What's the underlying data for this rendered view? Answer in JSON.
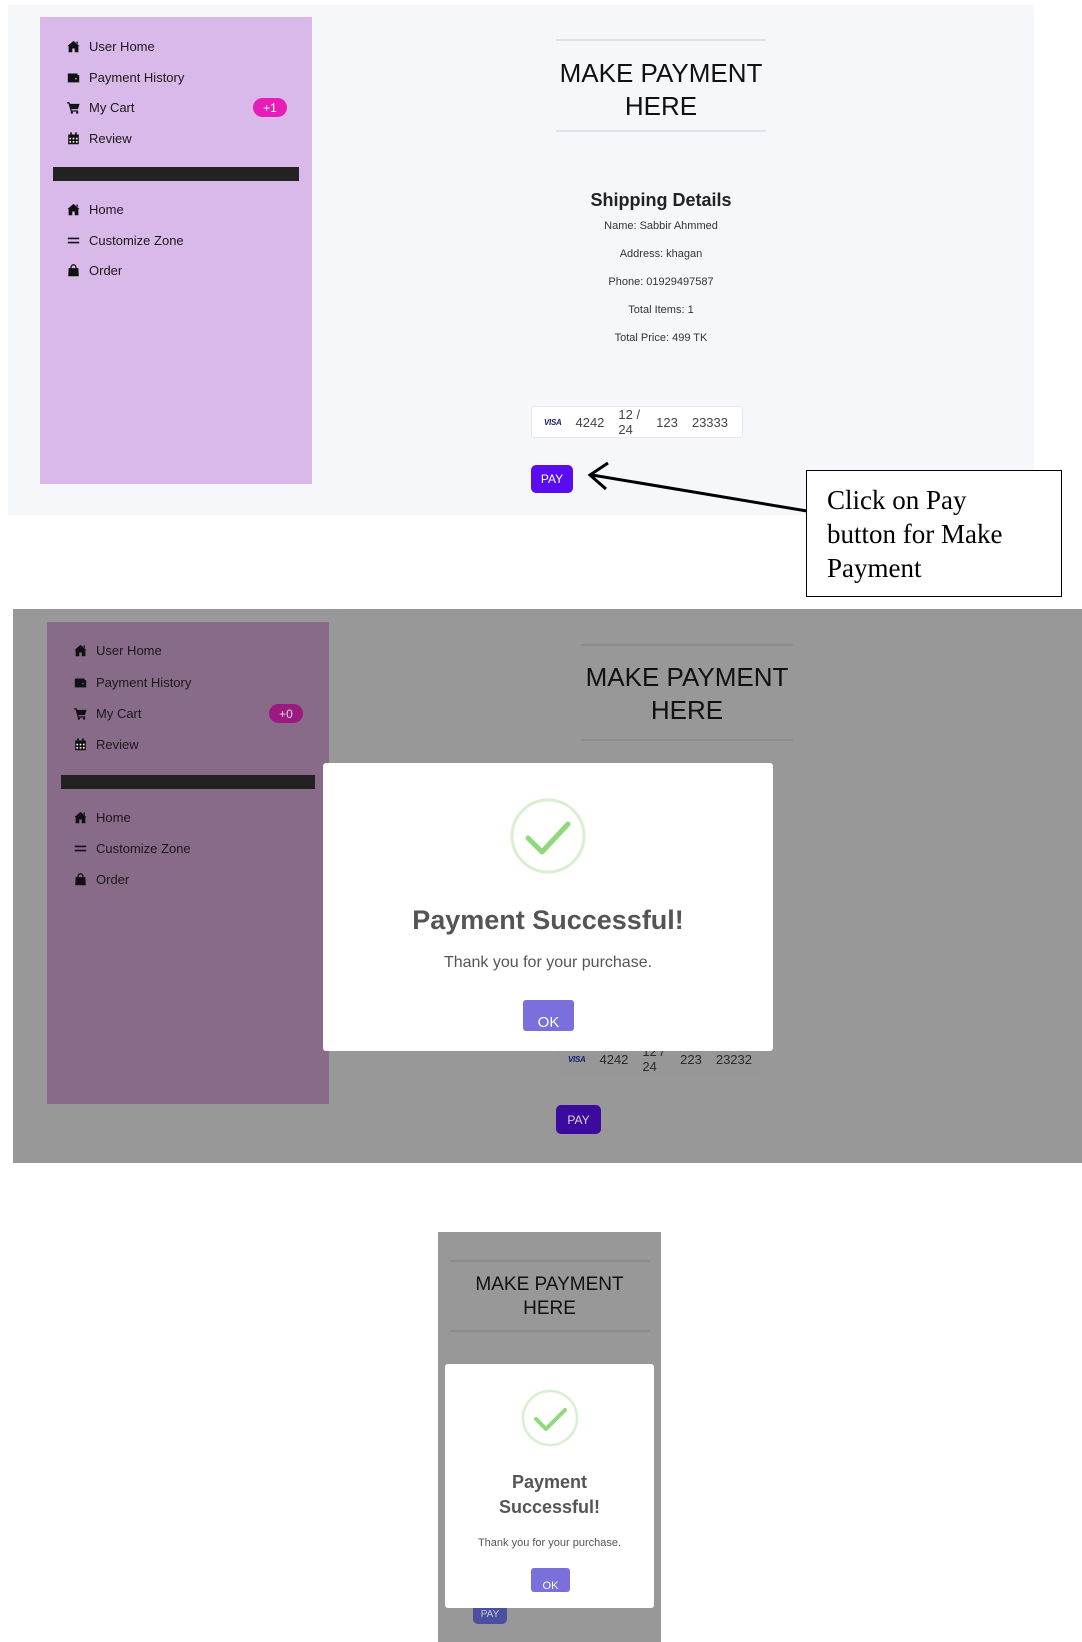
{
  "sidebar": {
    "items": [
      {
        "label": "User Home",
        "icon": "home-icon"
      },
      {
        "label": "Payment History",
        "icon": "wallet-icon"
      },
      {
        "label": "My Cart",
        "icon": "cart-icon"
      },
      {
        "label": "Review",
        "icon": "calendar-icon"
      },
      {
        "label": "Home",
        "icon": "home-icon"
      },
      {
        "label": "Customize Zone",
        "icon": "bars-icon"
      },
      {
        "label": "Order",
        "icon": "bag-icon"
      }
    ],
    "cart_badge_1": "+1",
    "cart_badge_2": "+0"
  },
  "main": {
    "title_line1": "MAKE PAYMENT",
    "title_line2": "HERE",
    "shipping": {
      "heading": "Shipping Details",
      "name": "Name: Sabbir Ahmmed",
      "address": "Address: khagan",
      "phone": "Phone: 01929497587",
      "items": "Total Items: 1",
      "price": "Total Price: 499 TK"
    },
    "card1": {
      "brand": "VISA",
      "number": "4242",
      "expiry": "12 / 24",
      "cvc": "123",
      "zip": "23333"
    },
    "card2": {
      "brand": "VISA",
      "number": "4242",
      "expiry": "12 / 24",
      "cvc": "223",
      "zip": "23232"
    },
    "pay_label": "PAY"
  },
  "callout": {
    "line1": "Click on Pay",
    "line2": "button for Make",
    "line3": "Payment"
  },
  "modal": {
    "heading": "Payment Successful!",
    "heading_line1": "Payment",
    "heading_line2": "Successful!",
    "message": "Thank you for your purchase.",
    "ok_label": "OK"
  },
  "colors": {
    "sidebar": "#d9b8ea",
    "sidebar_dimmed": "#876b88",
    "page_bg": "#f5f7fa",
    "overlay": "#989898",
    "badge": "#e020b0",
    "pay": "#5a0cf0",
    "ok": "#7b6fdc",
    "check": "#8fd97a"
  }
}
